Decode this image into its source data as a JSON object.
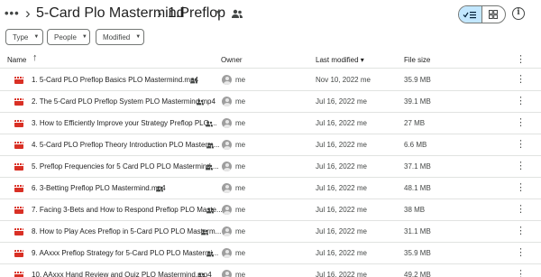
{
  "breadcrumb": {
    "more": "•••",
    "separator": "›",
    "parent": "5-Card Plo Mastermind",
    "current": "1.Preflop",
    "caret": "▾"
  },
  "view_toggle": {
    "list_icon": "check-list-icon",
    "grid_icon": "grid-icon"
  },
  "info_icon": "i",
  "filters": {
    "type": "Type",
    "people": "People",
    "modified": "Modified",
    "arrow": "▼"
  },
  "columns": {
    "name": "Name",
    "sort": "↑",
    "owner": "Owner",
    "last_modified": "Last modified ▾",
    "file_size": "File size",
    "more": "⋮"
  },
  "rows": [
    {
      "name": "1. 5-Card PLO Preflop Basics PLO Mastermind.mp4",
      "owner": "me",
      "modified": "Nov 10, 2022 me",
      "size": "35.9 MB"
    },
    {
      "name": "2. The 5-Card PLO Preflop System PLO Mastermind.mp4",
      "owner": "me",
      "modified": "Jul 16, 2022 me",
      "size": "39.1 MB"
    },
    {
      "name": "3. How to Efficiently Improve your Strategy Preflop PLO ...",
      "owner": "me",
      "modified": "Jul 16, 2022 me",
      "size": "27 MB"
    },
    {
      "name": "4. 5-Card PLO Preflop Theory Introduction PLO Masterm...",
      "owner": "me",
      "modified": "Jul 16, 2022 me",
      "size": "6.6 MB"
    },
    {
      "name": "5. Preflop Frequencies for 5 Card PLO PLO Mastermind....",
      "owner": "me",
      "modified": "Jul 16, 2022 me",
      "size": "37.1 MB"
    },
    {
      "name": "6. 3-Betting Preflop PLO Mastermind.mp4",
      "owner": "me",
      "modified": "Jul 16, 2022 me",
      "size": "48.1 MB"
    },
    {
      "name": "7. Facing 3-Bets and How to Respond Preflop PLO Maste...",
      "owner": "me",
      "modified": "Jul 16, 2022 me",
      "size": "38 MB"
    },
    {
      "name": "8. How to Play Aces Preflop in 5-Card PLO PLO Masterm...",
      "owner": "me",
      "modified": "Jul 16, 2022 me",
      "size": "31.1 MB"
    },
    {
      "name": "9. AAxxx Preflop Strategy for 5-Card PLO PLO Mastermi...",
      "owner": "me",
      "modified": "Jul 16, 2022 me",
      "size": "35.9 MB"
    },
    {
      "name": "10. AAxxx Hand Review and Quiz PLO Mastermind.mp4",
      "owner": "me",
      "modified": "Jul 16, 2022 me",
      "size": "49.2 MB"
    }
  ],
  "row_kebab": "⋮",
  "colors": {
    "accent": "#c2e7ff",
    "video_icon": "#d93025",
    "divider": "#e1e3e1"
  }
}
